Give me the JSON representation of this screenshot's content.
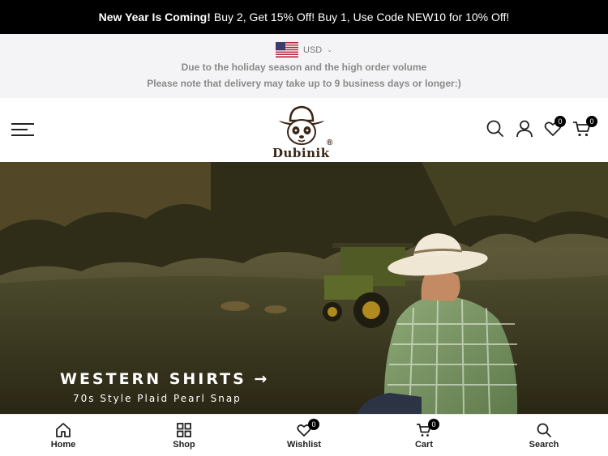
{
  "promo": {
    "bold_text": "New Year Is Coming!",
    "text": "Buy 2, Get 15% Off! Buy 1, Use Code NEW10 for 10% Off!"
  },
  "notice": {
    "currency": "USD",
    "line1": "Due to the holiday season and the high order volume",
    "line2": "Please note that delivery may take up to 9 business days or longer:)"
  },
  "header": {
    "brand": "Dubinik",
    "registered_mark": "®",
    "wishlist_count": "0",
    "cart_count": "0"
  },
  "hero": {
    "title": "WESTERN SHIRTS",
    "arrow": "→",
    "subtitle": "70s Style Plaid Pearl Snap"
  },
  "bottom_nav": {
    "items": [
      {
        "label": "Home",
        "icon": "home-icon"
      },
      {
        "label": "Shop",
        "icon": "grid-icon"
      },
      {
        "label": "Wishlist",
        "icon": "heart-icon",
        "badge": "0"
      },
      {
        "label": "Cart",
        "icon": "cart-icon",
        "badge": "0"
      },
      {
        "label": "Search",
        "icon": "search-icon"
      }
    ]
  }
}
